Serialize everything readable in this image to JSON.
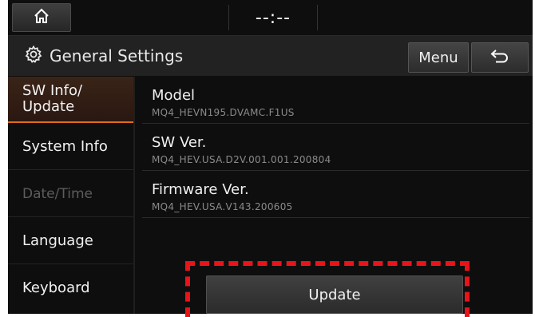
{
  "topbar": {
    "home_icon": "home-icon",
    "clock": "--:--"
  },
  "header": {
    "title": "General Settings",
    "settings_icon": "gear-icon",
    "menu_label": "Menu",
    "back_icon": "back-arrow-icon"
  },
  "sidebar": {
    "items": [
      {
        "label": "SW Info/\nUpdate",
        "state": "active"
      },
      {
        "label": "System Info",
        "state": "normal"
      },
      {
        "label": "Date/Time",
        "state": "disabled"
      },
      {
        "label": "Language",
        "state": "normal"
      },
      {
        "label": "Keyboard",
        "state": "normal"
      }
    ]
  },
  "info": [
    {
      "label": "Model",
      "value": "MQ4_HEVN195.DVAMC.F1US"
    },
    {
      "label": "SW Ver.",
      "value": "MQ4_HEV.USA.D2V.001.001.200804"
    },
    {
      "label": "Firmware Ver.",
      "value": "MQ4_HEV.USA.V143.200605"
    }
  ],
  "update_label": "Update",
  "colors": {
    "accent": "#e06a1b",
    "highlight": "#e8141a",
    "background": "#0e0e0e"
  }
}
